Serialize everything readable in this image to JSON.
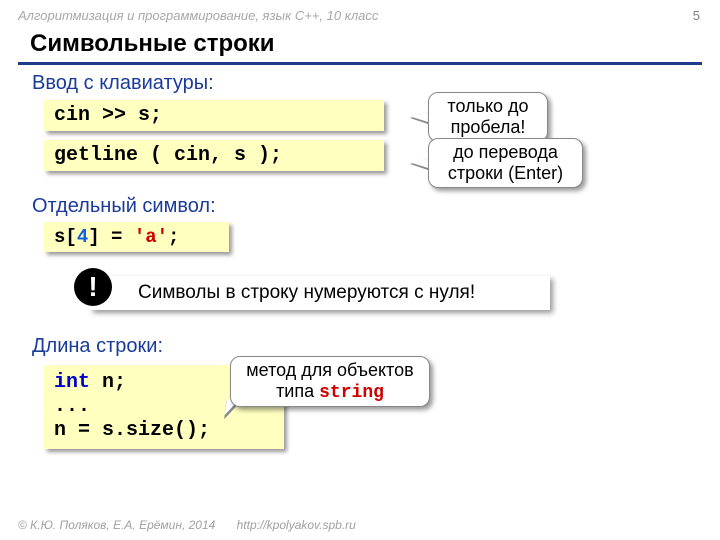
{
  "header": "Алгоритмизация и программирование, язык C++, 10 класс",
  "page_number": "5",
  "title": "Символьные строки",
  "sections": {
    "input": "Ввод с клавиатуры:",
    "single": "Отдельный символ:",
    "length": "Длина строки:"
  },
  "code": {
    "cin": "cin >> s;",
    "getline": "getline ( cin, s );",
    "assign_pre": "s[",
    "assign_idx": "4",
    "assign_mid": "] = ",
    "assign_chr": "'a'",
    "assign_post": ";",
    "len_kw": "int",
    "len_decl": " n;",
    "len_dots": "...",
    "len_call": "n = s.size();"
  },
  "callouts": {
    "space": "только до пробела!",
    "enter": "до перевода строки (Enter)",
    "method_pre": "метод для объектов типа ",
    "method_type": "string"
  },
  "alert": {
    "badge": "!",
    "text": "Символы в строку нумеруются с нуля!"
  },
  "footer": {
    "copyright": "© К.Ю. Поляков, Е.А. Ерёмин, 2014",
    "url": "http://kpolyakov.spb.ru"
  }
}
